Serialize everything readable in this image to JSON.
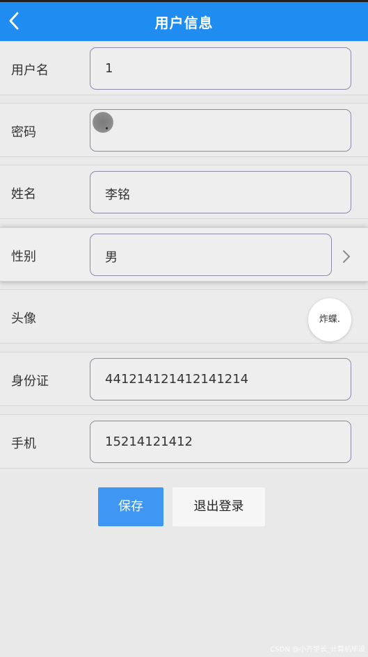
{
  "header": {
    "title": "用户信息"
  },
  "form": {
    "username": {
      "label": "用户名",
      "value": "1"
    },
    "password": {
      "label": "密码",
      "value": ""
    },
    "name": {
      "label": "姓名",
      "value": "李铭"
    },
    "gender": {
      "label": "性别",
      "value": "男"
    },
    "avatar": {
      "label": "头像",
      "image_text": "炸蝶."
    },
    "id_card": {
      "label": "身份证",
      "value": "441214121412141214"
    },
    "phone": {
      "label": "手机",
      "value": "15214121412"
    }
  },
  "actions": {
    "save_label": "保存",
    "logout_label": "退出登录"
  },
  "watermark": "CSDN @小齐学长_计算机毕设",
  "colors": {
    "header_bg": "#1e8cf0",
    "save_bg": "#3f97f3"
  },
  "icons": {
    "back": "chevron-left-icon",
    "gender_more": "chevron-right-icon"
  }
}
